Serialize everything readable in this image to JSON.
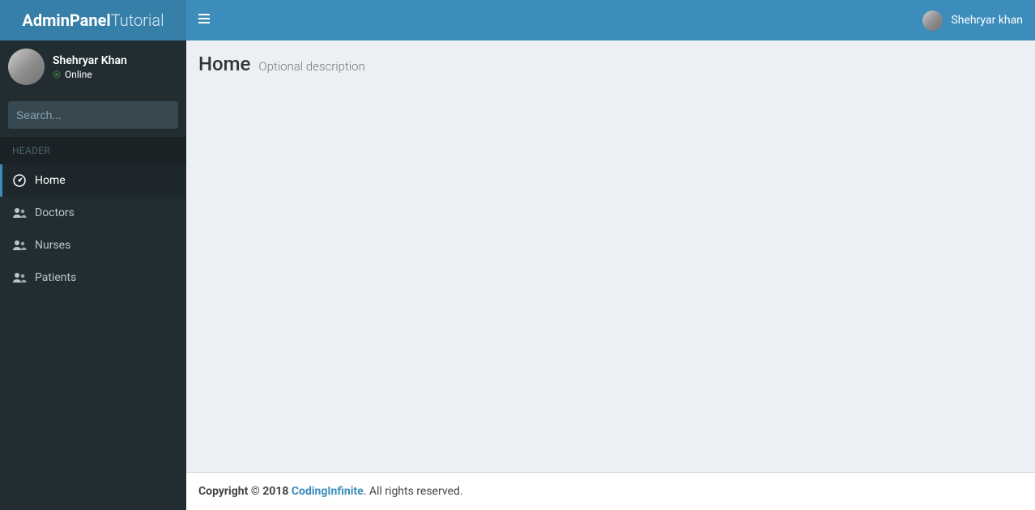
{
  "brand": {
    "bold": "AdminPanel",
    "light": "Tutorial"
  },
  "sidebar": {
    "user": {
      "name": "Shehryar Khan",
      "status_text": "Online"
    },
    "search": {
      "placeholder": "Search..."
    },
    "header_label": "HEADER",
    "items": [
      {
        "label": "Home",
        "icon": "dashboard",
        "active": true
      },
      {
        "label": "Doctors",
        "icon": "users",
        "active": false
      },
      {
        "label": "Nurses",
        "icon": "users",
        "active": false
      },
      {
        "label": "Patients",
        "icon": "users",
        "active": false
      }
    ]
  },
  "topbar": {
    "user_name": "Shehryar khan"
  },
  "page": {
    "title": "Home",
    "description": "Optional description"
  },
  "footer": {
    "copyright_prefix": "Copyright © 2018 ",
    "link_text": "CodingInfinite",
    "suffix": ". All rights reserved."
  }
}
